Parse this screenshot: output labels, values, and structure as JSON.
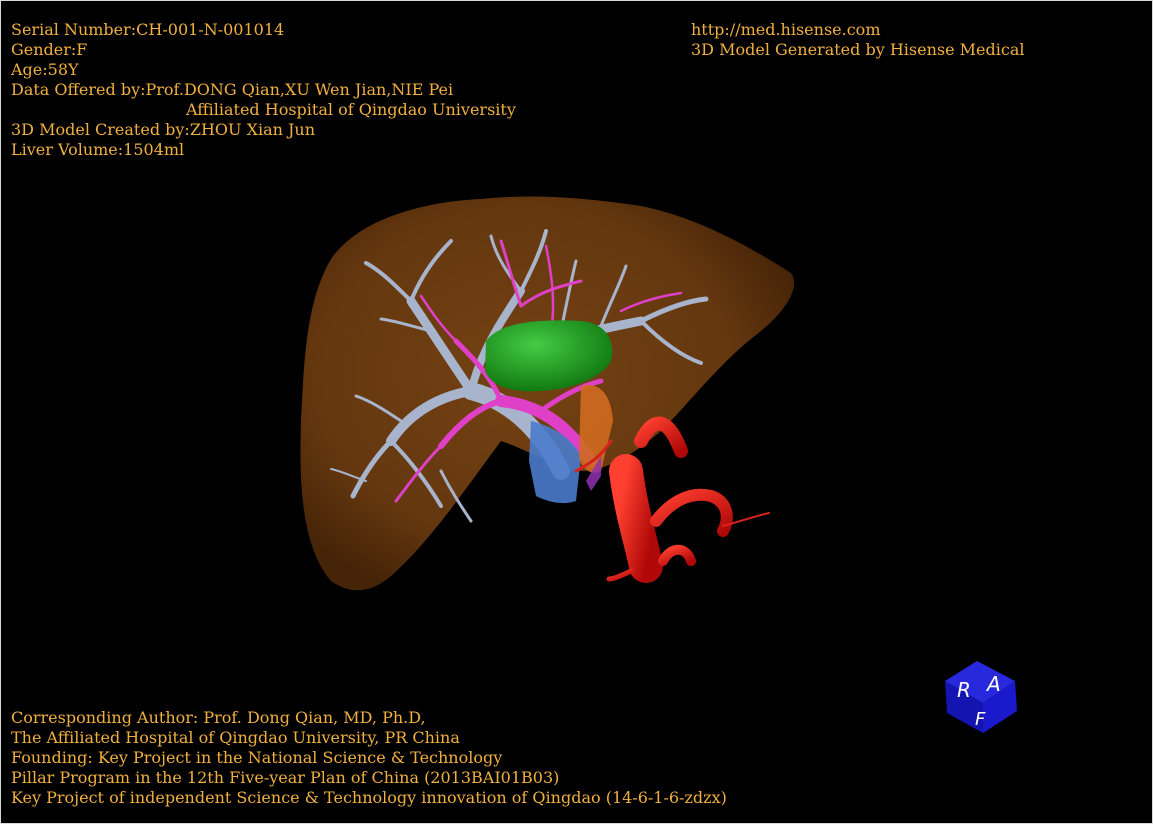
{
  "window": {
    "background": "#000000",
    "text_color": "#f0b040"
  },
  "patient_info": {
    "serial": "Serial Number:CH-001-N-001014",
    "gender": "Gender:F",
    "age": "Age:58Y",
    "data_offered": "Data Offered by:Prof.DONG Qian,XU Wen Jian,NIE Pei",
    "hospital": "Affiliated Hospital of Qingdao University",
    "model_created": "3D Model Created by:ZHOU Xian Jun",
    "liver_volume": "Liver Volume:1504ml"
  },
  "branding": {
    "url": "http://med.hisense.com",
    "generated_by": "3D Model Generated by Hisense Medical"
  },
  "credits": {
    "line1": "Corresponding Author: Prof. Dong Qian, MD, Ph.D,",
    "line2": "The Affiliated Hospital of Qingdao University, PR China",
    "line3": "Founding: Key Project in the National Science & Technology",
    "line4": "Pillar Program in the 12th Five-year Plan of China (2013BAI01B03)",
    "line5": "Key Project of independent Science & Technology innovation of Qingdao (14-6-1-6-zdzx)"
  },
  "orientation_cube": {
    "labels": [
      "R",
      "A",
      "F"
    ],
    "color": "#1a1acc"
  },
  "model_colors": {
    "liver": "#8a4a14",
    "portal_vein": "#aab4c8",
    "hepatic_artery": "#e040c8",
    "gallbladder": "#22aa22",
    "aorta": "#dd1111",
    "ivc": "#4a7acc"
  }
}
